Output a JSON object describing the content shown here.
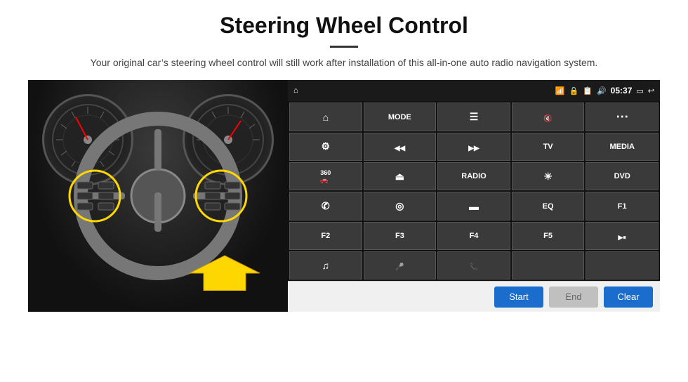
{
  "header": {
    "title": "Steering Wheel Control",
    "divider": true,
    "subtitle": "Your original car’s steering wheel control will still work after installation of this all-in-one auto radio navigation system."
  },
  "status_bar": {
    "time": "05:37",
    "icons": [
      "wifi",
      "lock",
      "sd",
      "bluetooth",
      "back"
    ]
  },
  "control_panel": {
    "rows": [
      [
        {
          "label": "",
          "icon": "home",
          "type": "icon"
        },
        {
          "label": "MODE",
          "icon": "",
          "type": "text"
        },
        {
          "label": "",
          "icon": "list",
          "type": "icon"
        },
        {
          "label": "",
          "icon": "vol-mute",
          "type": "icon"
        },
        {
          "label": "",
          "icon": "apps",
          "type": "icon"
        }
      ],
      [
        {
          "label": "",
          "icon": "settings",
          "type": "icon"
        },
        {
          "label": "",
          "icon": "prev",
          "type": "icon"
        },
        {
          "label": "",
          "icon": "next",
          "type": "icon"
        },
        {
          "label": "TV",
          "icon": "",
          "type": "text"
        },
        {
          "label": "MEDIA",
          "icon": "",
          "type": "text"
        }
      ],
      [
        {
          "label": "",
          "icon": "360",
          "type": "icon"
        },
        {
          "label": "",
          "icon": "eject",
          "type": "icon"
        },
        {
          "label": "RADIO",
          "icon": "",
          "type": "text"
        },
        {
          "label": "",
          "icon": "bright",
          "type": "icon"
        },
        {
          "label": "DVD",
          "icon": "",
          "type": "text"
        }
      ],
      [
        {
          "label": "",
          "icon": "phone",
          "type": "icon"
        },
        {
          "label": "",
          "icon": "ie",
          "type": "icon"
        },
        {
          "label": "",
          "icon": "bar",
          "type": "icon"
        },
        {
          "label": "EQ",
          "icon": "",
          "type": "text"
        },
        {
          "label": "F1",
          "icon": "",
          "type": "text"
        }
      ],
      [
        {
          "label": "F2",
          "icon": "",
          "type": "text"
        },
        {
          "label": "F3",
          "icon": "",
          "type": "text"
        },
        {
          "label": "F4",
          "icon": "",
          "type": "text"
        },
        {
          "label": "F5",
          "icon": "",
          "type": "text"
        },
        {
          "label": "",
          "icon": "play-pause",
          "type": "icon"
        }
      ],
      [
        {
          "label": "",
          "icon": "music",
          "type": "icon"
        },
        {
          "label": "",
          "icon": "mic",
          "type": "icon"
        },
        {
          "label": "",
          "icon": "tel",
          "type": "icon"
        },
        {
          "label": "",
          "icon": "",
          "type": "empty"
        },
        {
          "label": "",
          "icon": "",
          "type": "empty"
        }
      ]
    ]
  },
  "action_bar": {
    "start_label": "Start",
    "end_label": "End",
    "clear_label": "Clear"
  }
}
